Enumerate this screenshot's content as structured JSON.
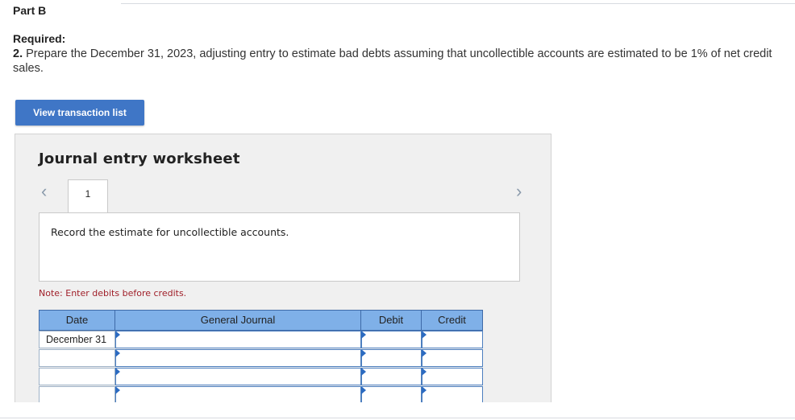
{
  "part_label": "Part B",
  "required_label": "Required:",
  "requirement": {
    "number": "2.",
    "text": "Prepare the December 31, 2023, adjusting entry to estimate bad debts assuming that uncollectible accounts are estimated to be 1% of net credit sales."
  },
  "view_transaction_button": "View transaction list",
  "worksheet": {
    "title": "Journal entry worksheet",
    "prev_icon": "chevron-left-icon",
    "next_icon": "chevron-right-icon",
    "active_tab": "1",
    "instruction": "Record the estimate for uncollectible accounts.",
    "note": "Note: Enter debits before credits.",
    "table": {
      "columns": [
        "Date",
        "General Journal",
        "Debit",
        "Credit"
      ],
      "rows": [
        {
          "date": "December 31",
          "account": "",
          "debit": "",
          "credit": ""
        },
        {
          "date": "",
          "account": "",
          "debit": "",
          "credit": ""
        },
        {
          "date": "",
          "account": "",
          "debit": "",
          "credit": ""
        },
        {
          "date": "",
          "account": "",
          "debit": "",
          "credit": ""
        }
      ]
    }
  },
  "colors": {
    "button_bg": "#3f76c6",
    "header_bg": "#7fb0e8",
    "note_text": "#a0202a",
    "dropdown_marker": "#2c6bc1"
  }
}
